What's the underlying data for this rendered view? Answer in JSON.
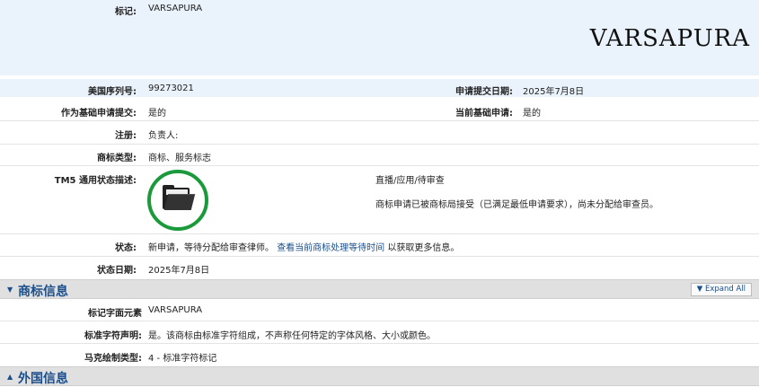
{
  "mark": {
    "label": "标记:",
    "value": "VARSAPURA",
    "image_text": "VARSAPURA"
  },
  "serial": {
    "label": "美国序列号:",
    "value": "99273021"
  },
  "filing_date": {
    "label": "申请提交日期:",
    "value": "2025年7月8日"
  },
  "filed_as_basis": {
    "label": "作为基础申请提交:",
    "value": "是的"
  },
  "current_basis": {
    "label": "当前基础申请:",
    "value": "是的"
  },
  "register": {
    "label": "注册:",
    "value": "负责人:"
  },
  "mark_type": {
    "label": "商标类型:",
    "value": "商标、服务标志"
  },
  "tm5": {
    "label": "TM5 通用状态描述:",
    "status_title": "直播/应用/待审查",
    "status_desc": "商标申请已被商标局接受（已满足最低申请要求），尚未分配给审查员。",
    "icon": "open-folder-icon",
    "circle_color": "#1a9a3a"
  },
  "status": {
    "label": "状态:",
    "text_before": "新申请，等待分配给审查律师。",
    "link": "查看当前商标处理等待时间",
    "text_after": "以获取更多信息。"
  },
  "status_date": {
    "label": "状态日期:",
    "value": "2025年7月8日"
  },
  "section_mark_info": {
    "title": "商标信息",
    "expand_label": "Expand All",
    "rows": [
      {
        "label": "标记字面元素",
        "value": "VARSAPURA"
      },
      {
        "label": "标准字符声明:",
        "value": "是。该商标由标准字符组成，不声称任何特定的字体风格、大小或颜色。"
      },
      {
        "label": "马克绘制类型:",
        "value": "4 - 标准字符标记"
      }
    ]
  },
  "section_foreign": {
    "title": "外国信息"
  },
  "colors": {
    "accent": "#1a4e8c",
    "label_bg": "#eaf2fb"
  }
}
